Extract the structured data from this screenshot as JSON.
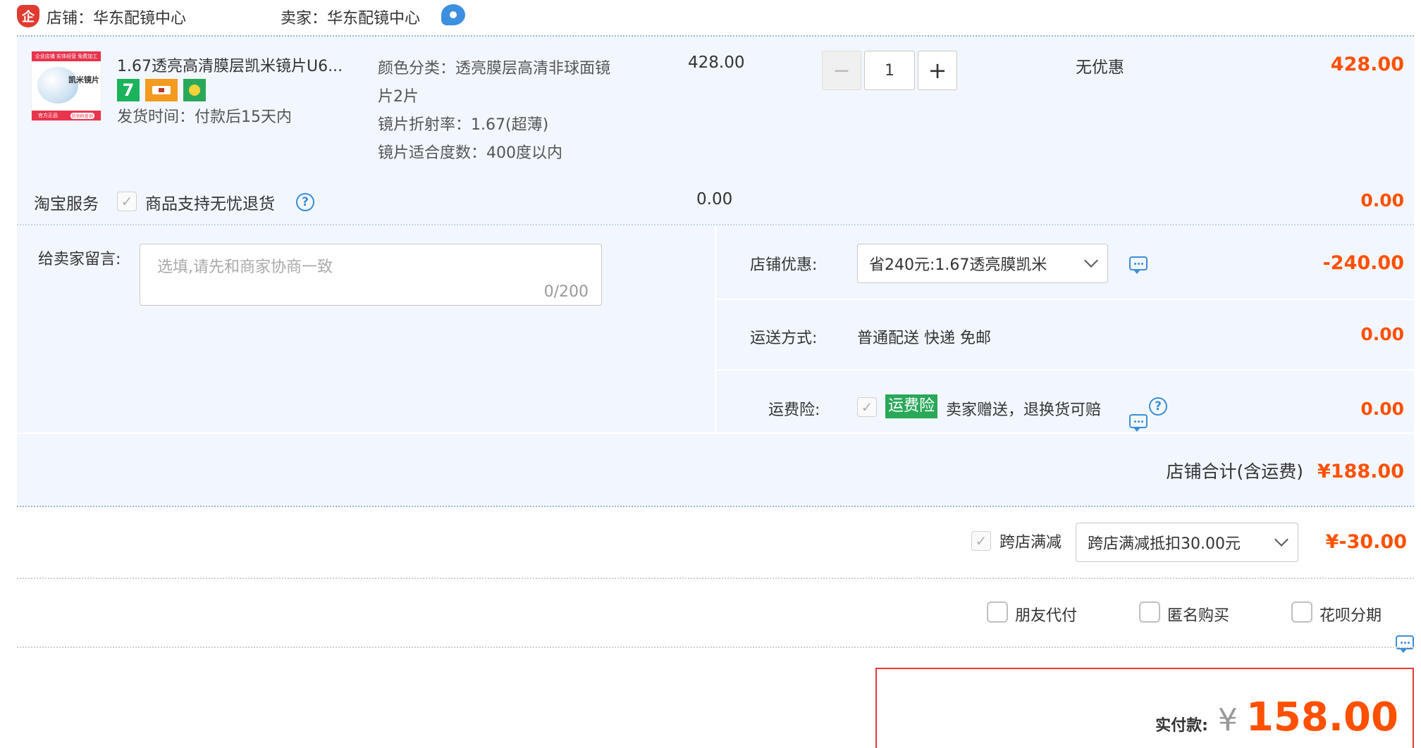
{
  "shop_header": {
    "shop_label": "店铺：华东配镜中心",
    "seller_label": "卖家：华东配镜中心"
  },
  "product": {
    "thumbnail_text_top": "企业店铺 实体经营 免费加工",
    "thumbnail_text_mid": "凯米镜片",
    "thumbnail_text_bottom": "官方正品",
    "thumbnail_text_badge": "防伪码查询",
    "title": "1.67透亮高清膜层凯米镜片U6...",
    "ship_time": "发货时间：付款后15天内",
    "badge_seven": "7",
    "spec_color_line1": "颜色分类：透亮膜层高清非球面镜",
    "spec_color_line2": "片2片",
    "spec_index": "镜片折射率：1.67(超薄)",
    "spec_degree": "镜片适合度数：400度以内",
    "unit_price": "428.00",
    "quantity": "1",
    "qty_minus": "−",
    "qty_plus": "+",
    "discount": "无优惠",
    "subtotal": "428.00"
  },
  "taobao_service": {
    "label": "淘宝服务",
    "item": "商品支持无忧退货",
    "price": "0.00",
    "subtotal": "0.00"
  },
  "message": {
    "label": "给卖家留言:",
    "placeholder": "选填,请先和商家协商一致",
    "counter": "0/200"
  },
  "shop_coupon": {
    "label": "店铺优惠:",
    "selected": "省240元:1.67透亮膜凯米",
    "amount": "-240.00"
  },
  "shipping": {
    "label": "运送方式:",
    "value": "普通配送 快递 免邮",
    "amount": "0.00"
  },
  "freight_insurance": {
    "label": "运费险:",
    "tag": "运费险",
    "desc": "卖家赠送，退换货可赔",
    "amount": "0.00"
  },
  "shop_total": {
    "label": "店铺合计(含运费)",
    "amount": "¥188.00"
  },
  "cross_store": {
    "label": "跨店满减",
    "selected": "跨店满减抵扣30.00元",
    "amount": "¥-30.00"
  },
  "options": {
    "friend_pay": "朋友代付",
    "anonymous": "匿名购买",
    "huabei": "花呗分期"
  },
  "payment": {
    "label": "实付款:",
    "currency": "¥",
    "amount": "158.00"
  },
  "colors": {
    "accent": "#ff5000",
    "panel_bg": "#f2f7ff",
    "border_dotted": "#8fb6e8",
    "link_blue": "#3c8ed8",
    "green_tag": "#2aa85a",
    "pay_box_border": "#e4393c"
  }
}
